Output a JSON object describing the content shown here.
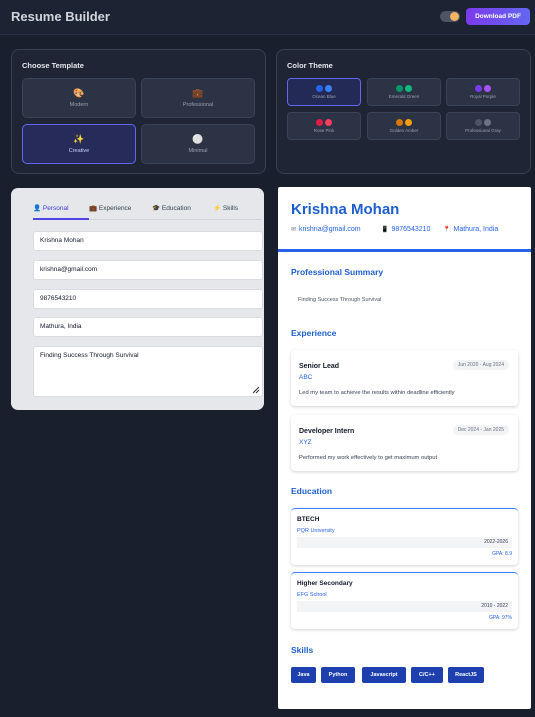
{
  "header": {
    "title": "Resume Builder",
    "download_label": "Download PDF"
  },
  "template_panel": {
    "title": "Choose Template",
    "templates": [
      {
        "icon": "🎨",
        "label": "Modern"
      },
      {
        "icon": "💼",
        "label": "Professional"
      },
      {
        "icon": "✨",
        "label": "Creative"
      },
      {
        "icon": "⚪",
        "label": "Minimal"
      }
    ],
    "selected": "Creative"
  },
  "theme_panel": {
    "title": "Color Theme",
    "themes": [
      {
        "label": "Ocean Blue",
        "colors": [
          "#2563eb",
          "#3b82f6"
        ]
      },
      {
        "label": "Emerald Green",
        "colors": [
          "#059669",
          "#10b981"
        ]
      },
      {
        "label": "Royal Purple",
        "colors": [
          "#7c3aed",
          "#a855f7"
        ]
      },
      {
        "label": "Rose Pink",
        "colors": [
          "#e11d48",
          "#f43f5e"
        ]
      },
      {
        "label": "Golden Amber",
        "colors": [
          "#d97706",
          "#f59e0b"
        ]
      },
      {
        "label": "Professional Gray",
        "colors": [
          "#4b5563",
          "#6b7280"
        ]
      }
    ],
    "selected": "Ocean Blue"
  },
  "editor": {
    "tabs": [
      {
        "icon": "👤",
        "label": "Personal"
      },
      {
        "icon": "💼",
        "label": "Experience"
      },
      {
        "icon": "🎓",
        "label": "Education"
      },
      {
        "icon": "⚡",
        "label": "Skills"
      }
    ],
    "active_tab": "Personal",
    "fields": {
      "name": "Krishna Mohan",
      "email": "krishna@gmail.com",
      "phone": "9876543210",
      "location": "Mathura, India",
      "summary": "Finding Success Through Survival"
    }
  },
  "resume": {
    "name": "Krishna Mohan",
    "email": "krishna@gmail.com",
    "phone": "9876543210",
    "location": "Mathura, India",
    "icons": {
      "email": "✉",
      "phone": "📱",
      "location": "📍"
    },
    "sections": {
      "summary": "Professional Summary",
      "experience": "Experience",
      "education": "Education",
      "skills": "Skills"
    },
    "summary": "Finding Success Through Survival",
    "experience": [
      {
        "role": "Senior Lead",
        "company": "ABC",
        "dates": "Jun 2020 - Aug 2024",
        "description": "Led my team to achieve the results within deadline efficiently"
      },
      {
        "role": "Developer Intern",
        "company": "XYZ",
        "dates": "Dec 2024 - Jan 2025",
        "description": "Performed my work effectively to get maximum output"
      }
    ],
    "education": [
      {
        "degree": "BTECH",
        "school": "PQR University",
        "years": "2022-2026",
        "gpa": "GPA: 8.9"
      },
      {
        "degree": "Higher Secondary",
        "school": "EFG School",
        "years": "2010 - 2022",
        "gpa": "GPA: 97%"
      }
    ],
    "skills": [
      "Java",
      "Python",
      "Javascript",
      "C/C++",
      "ReactJS"
    ]
  }
}
